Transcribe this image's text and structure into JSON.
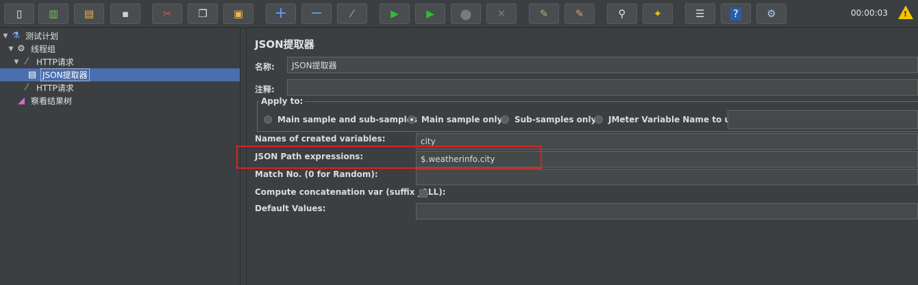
{
  "toolbar": {
    "buttons": [
      {
        "name": "new-icon",
        "glyph": "▯"
      },
      {
        "name": "templates-icon",
        "glyph": "▥"
      },
      {
        "name": "open-icon",
        "glyph": "▤"
      },
      {
        "name": "save-icon",
        "glyph": "▪"
      },
      {
        "name": "cut-icon",
        "glyph": "✂"
      },
      {
        "name": "copy-icon",
        "glyph": "❐"
      },
      {
        "name": "paste-icon",
        "glyph": "▣"
      },
      {
        "name": "expand-icon",
        "glyph": "+"
      },
      {
        "name": "collapse-icon",
        "glyph": "−"
      },
      {
        "name": "toggle-icon",
        "glyph": "⁄"
      },
      {
        "name": "start-icon",
        "glyph": "▶"
      },
      {
        "name": "start-no-pause-icon",
        "glyph": "▶"
      },
      {
        "name": "stop-icon",
        "glyph": "■"
      },
      {
        "name": "shutdown-icon",
        "glyph": "✕"
      },
      {
        "name": "clear-icon",
        "glyph": "✎"
      },
      {
        "name": "clear-all-icon",
        "glyph": "✎"
      },
      {
        "name": "search-icon",
        "glyph": "⚲"
      },
      {
        "name": "reset-search-icon",
        "glyph": "✦"
      },
      {
        "name": "function-helper-icon",
        "glyph": "☰"
      },
      {
        "name": "help-icon",
        "glyph": "?"
      },
      {
        "name": "remote-icon",
        "glyph": "⚙"
      }
    ],
    "timer": "00:00:03",
    "warning_icon": "warning-icon"
  },
  "tree": {
    "items": [
      {
        "label": "测试计划",
        "icon": "flask-icon"
      },
      {
        "label": "线程组",
        "icon": "gear-icon"
      },
      {
        "label": "HTTP请求",
        "icon": "pipette-icon"
      },
      {
        "label": "JSON提取器",
        "icon": "document-icon"
      },
      {
        "label": "HTTP请求",
        "icon": "pipette-icon"
      },
      {
        "label": "察看结果树",
        "icon": "chart-icon"
      }
    ]
  },
  "panel": {
    "title": "JSON提取器",
    "name_label": "名称:",
    "name_value": "JSON提取器",
    "comment_label": "注释:",
    "comment_value": "",
    "apply_to": {
      "legend": "Apply to:",
      "options": [
        "Main sample and sub-samples",
        "Main sample only",
        "Sub-samples only",
        "JMeter Variable Name to use"
      ],
      "selected": "Main sample only",
      "variable_value": ""
    },
    "names_label": "Names of created variables:",
    "names_value": "city",
    "json_path_label": "JSON Path expressions:",
    "json_path_value": "$.weatherinfo.city",
    "match_no_label": "Match No. (0 for Random):",
    "match_no_value": "",
    "concat_label": "Compute concatenation var (suffix _ALL):",
    "concat_checked": false,
    "default_label": "Default Values:",
    "default_value": ""
  },
  "colors": {
    "background": "#3c3f41",
    "selection": "#4b6eaf",
    "highlight_box": "#e02020",
    "warning": "#f2c400"
  }
}
